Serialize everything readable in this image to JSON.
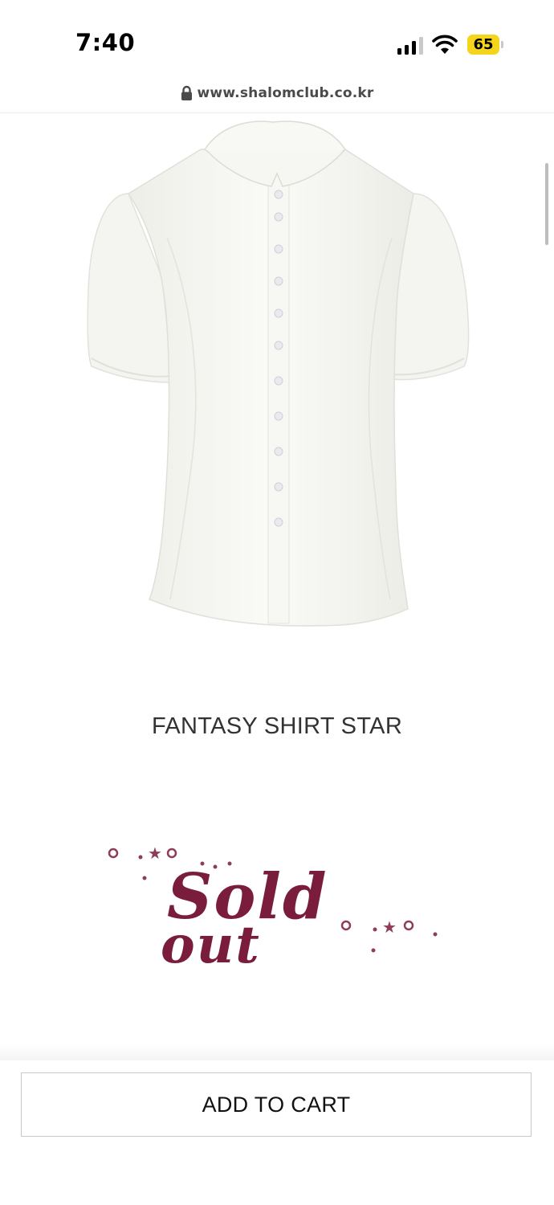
{
  "status_bar": {
    "time": "7:40",
    "battery_level": "65",
    "signal_bars_active": 3,
    "signal_bars_total": 4,
    "battery_color": "#f5d51c"
  },
  "browser": {
    "url": "www.shalomclub.co.kr"
  },
  "product": {
    "image_icon": "white-puff-sleeve-shirt",
    "name": "FANTASY SHIRT STAR",
    "sold_out_badge": {
      "line1": "Sold",
      "line2": "out",
      "color": "#7a1c3b"
    }
  },
  "actions": {
    "add_to_cart_label": "ADD TO CART"
  }
}
